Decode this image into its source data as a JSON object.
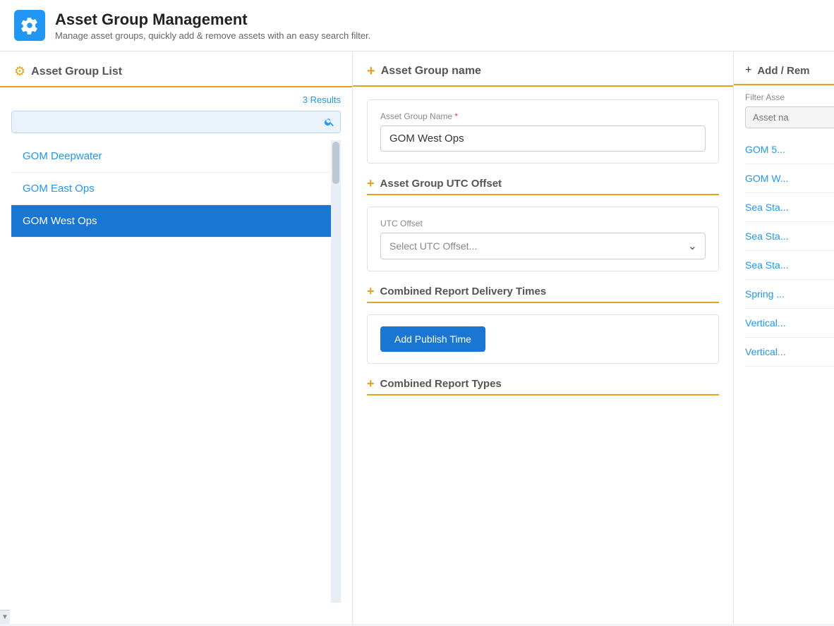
{
  "app": {
    "title": "Asset Group Management",
    "subtitle": "Manage asset groups, quickly add & remove assets with an easy search filter.",
    "icon": "gear"
  },
  "left_panel": {
    "section_title": "Asset Group List",
    "results_count": "3 Results",
    "search_placeholder": "",
    "items": [
      {
        "label": "GOM Deepwater",
        "active": false
      },
      {
        "label": "GOM East Ops",
        "active": false
      },
      {
        "label": "GOM West Ops",
        "active": true
      }
    ]
  },
  "middle_panel": {
    "section_title": "Asset Group name",
    "asset_group_name_label": "Asset Group Name",
    "asset_group_name_required": "*",
    "asset_group_name_value": "GOM West Ops",
    "utc_section_title": "Asset Group UTC Offset",
    "utc_label": "UTC Offset",
    "utc_placeholder": "Select UTC Offset...",
    "delivery_section_title": "Combined Report Delivery Times",
    "add_publish_label": "Add Publish Time",
    "combined_types_title": "Combined Report Types"
  },
  "right_panel": {
    "section_title": "Add / Rem",
    "filter_label": "Filter Asse",
    "filter_placeholder": "Asset na",
    "items": [
      {
        "label": "GOM 5..."
      },
      {
        "label": "GOM W..."
      },
      {
        "label": "Sea Sta..."
      },
      {
        "label": "Sea Sta..."
      },
      {
        "label": "Sea Sta..."
      },
      {
        "label": "Spring ..."
      },
      {
        "label": "Vertical..."
      },
      {
        "label": "Vertical..."
      }
    ]
  }
}
